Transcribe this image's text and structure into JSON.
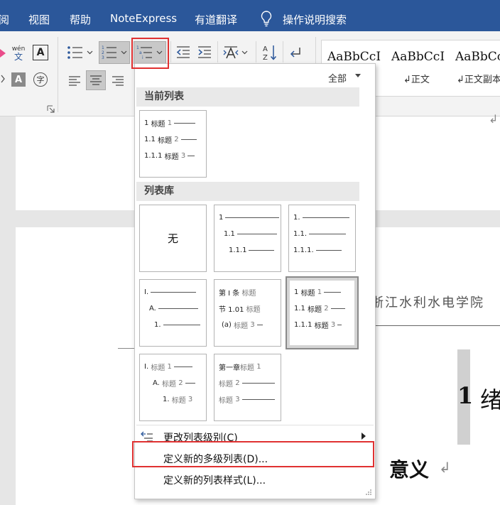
{
  "menubar": {
    "items": [
      "阅",
      "视图",
      "帮助",
      "NoteExpress",
      "有道翻译",
      "操作说明搜索"
    ]
  },
  "ribbon": {
    "wen_icon_text": "wén\n文",
    "a_letter": "A",
    "zi_char": "字",
    "sort_label": "A Z",
    "gallery": {
      "samples": [
        "AaBbCcI",
        "AaBbCcI",
        "AaBbCc"
      ],
      "names": [
        "↲正文",
        "↲正文副本"
      ]
    }
  },
  "dropdown": {
    "filter_label": "全部",
    "sections": {
      "current": "当前列表",
      "library": "列表库"
    },
    "current_tile": {
      "rows": [
        {
          "num": "1",
          "label": "标题",
          "lvl": "1"
        },
        {
          "num": "1.1",
          "label": "标题",
          "lvl": "2"
        },
        {
          "num": "1.1.1",
          "label": "标题",
          "lvl": "3"
        }
      ]
    },
    "library_tiles": [
      {
        "kind": "none",
        "text": "无"
      },
      {
        "kind": "plain",
        "rows": [
          "1",
          "1.1",
          "1.1.1"
        ]
      },
      {
        "kind": "plain",
        "rows": [
          "1.",
          "1.1.",
          "1.1.1."
        ]
      },
      {
        "kind": "plain",
        "rows": [
          "I.",
          "A.",
          "1."
        ]
      },
      {
        "kind": "heading",
        "rows": [
          {
            "num": "第 I 条",
            "label": "标题",
            "lvl": ""
          },
          {
            "num": "节 1.01",
            "label": "标题",
            "lvl": ""
          },
          {
            "num": "(a)",
            "label": "标题",
            "lvl": "3"
          }
        ]
      },
      {
        "kind": "heading",
        "selected": true,
        "rows": [
          {
            "num": "1",
            "label": "标题",
            "lvl": "1"
          },
          {
            "num": "1.1",
            "label": "标题",
            "lvl": "2"
          },
          {
            "num": "1.1.1",
            "label": "标题",
            "lvl": "3"
          }
        ]
      },
      {
        "kind": "heading",
        "rows": [
          {
            "num": "I.",
            "label": "标题",
            "lvl": "1"
          },
          {
            "num": "A.",
            "label": "标题",
            "lvl": "2"
          },
          {
            "num": "1.",
            "label": "标题",
            "lvl": "3"
          }
        ]
      },
      {
        "kind": "heading",
        "rows": [
          {
            "num": "第一章",
            "label": "标题",
            "lvl": "1"
          },
          {
            "num": "",
            "label": "标题",
            "lvl": "2"
          },
          {
            "num": "",
            "label": "标题",
            "lvl": "3"
          }
        ]
      }
    ],
    "commands": {
      "change_level": "更改列表级别(C)",
      "define_multilevel": "定义新的多级列表(D)...",
      "define_style": "定义新的列表样式(L)..."
    }
  },
  "document": {
    "affiliation": "浙江水利水电学院",
    "heading_num": "1",
    "heading_text": "绪",
    "subheading": "意义",
    "para_mark": "↲"
  },
  "colors": {
    "menubar": "#2b579a",
    "highlight_box": "#e03131"
  }
}
